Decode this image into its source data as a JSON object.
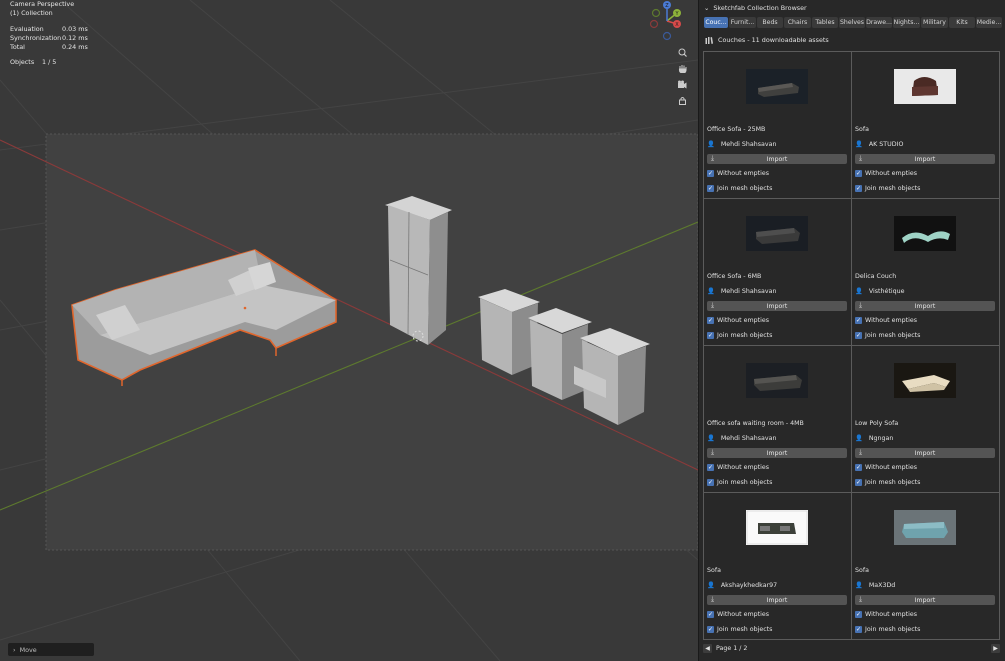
{
  "viewport": {
    "camera_label": "Camera Perspective",
    "collection_label": "(1) Collection",
    "stats": [
      {
        "key": "Evaluation",
        "value": "0.03 ms"
      },
      {
        "key": "Synchronization",
        "value": "0.12 ms"
      },
      {
        "key": "Total",
        "value": "0.24 ms"
      }
    ],
    "objects_key": "Objects",
    "objects_value": "1 / 5",
    "gizmo_axes": [
      "X",
      "Y",
      "Z"
    ],
    "nav_tools": [
      "zoom-icon",
      "hand-pan-icon",
      "camera-icon",
      "lock-icon"
    ],
    "operator_panel_label": "Move"
  },
  "panel": {
    "title": "Sketchfab Collection Browser",
    "tabs": [
      "Couc...",
      "Furnit...",
      "Beds",
      "Chairs",
      "Tables",
      "Shelves",
      "Drawe...",
      "Nights...",
      "Military",
      "Kits",
      "Medie..."
    ],
    "active_tab": "Couc...",
    "collection_info": "Couches - 11 downloadable assets",
    "import_label": "Import",
    "option_without_empties": "Without empties",
    "option_join_mesh": "Join mesh objects",
    "cards": [
      {
        "title": "Office Sofa - 25MB",
        "author": "Mehdi Shahsavan",
        "thumb": "dark-sofa"
      },
      {
        "title": "Sofa",
        "author": "AK STUDIO",
        "thumb": "brown-armchair"
      },
      {
        "title": "Office Sofa - 6MB",
        "author": "Mehdi Shahsavan",
        "thumb": "dark-sofa"
      },
      {
        "title": "Delica Couch",
        "author": "Visthétique",
        "thumb": "teal-couch"
      },
      {
        "title": "Office sofa waiting room - 4MB",
        "author": "Mehdi Shahsavan",
        "thumb": "dark-sofa"
      },
      {
        "title": "Low Poly  Sofa",
        "author": "Ngngan",
        "thumb": "beige-sectional"
      },
      {
        "title": "Sofa",
        "author": "Akshaykhedkar97",
        "thumb": "white-bg-sofa"
      },
      {
        "title": "Sofa",
        "author": "MaX3Dd",
        "thumb": "blue-sofa"
      }
    ],
    "pager": "Page 1 / 2"
  }
}
